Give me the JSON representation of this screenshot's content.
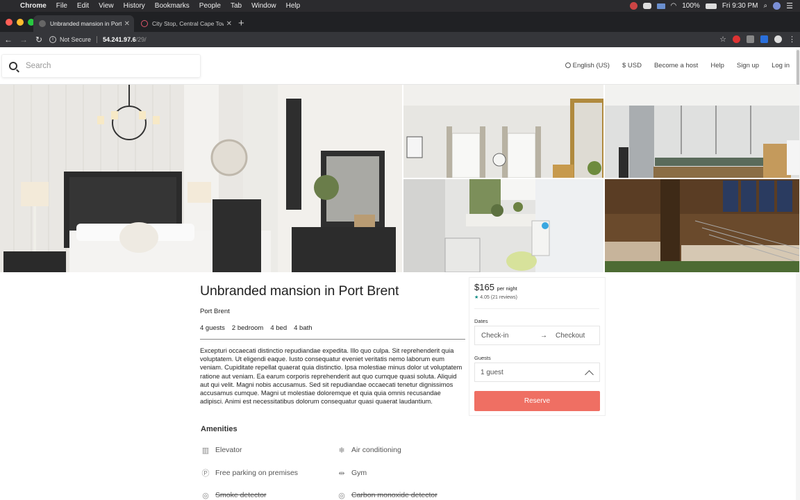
{
  "menubar": {
    "app": "Chrome",
    "items": [
      "File",
      "Edit",
      "View",
      "History",
      "Bookmarks",
      "People",
      "Tab",
      "Window",
      "Help"
    ],
    "battery": "100%",
    "clock": "Fri 9:30 PM"
  },
  "browser": {
    "tabs": [
      {
        "title": "Unbranded mansion in Port Bren",
        "active": true
      },
      {
        "title": "City Stop, Central Cape Town, Lo",
        "active": false
      }
    ],
    "address": {
      "security": "Not Secure",
      "host": "54.241.97.6",
      "path": "/29/"
    }
  },
  "header": {
    "search_placeholder": "Search",
    "nav": {
      "language": "English (US)",
      "currency": "$ USD",
      "host": "Become a host",
      "help": "Help",
      "signup": "Sign up",
      "login": "Log in"
    }
  },
  "listing": {
    "title": "Unbranded mansion in Port Brent",
    "city": "Port Brent",
    "specs": {
      "guests": "4 guests",
      "bedrooms": "2 bedroom",
      "beds": "4 bed",
      "baths": "4 bath"
    },
    "description": "Excepturi occaecati distinctio repudiandae expedita. Illo quo culpa. Sit reprehenderit quia voluptatem. Ut eligendi eaque. Iusto consequatur eveniet veritatis nemo laborum eum veniam. Cupiditate repellat quaerat quia distinctio. Ipsa molestiae minus dolor ut voluptatem ratione aut veniam. Ea earum corporis reprehenderit aut quo cumque quasi soluta. Aliquid aut qui velit. Magni nobis accusamus. Sed sit repudiandae occaecati tenetur dignissimos accusamus cumque. Magni ut molestiae doloremque et quia quia omnis recusandae adipisci. Animi est necessitatibus dolorum consequatur quasi quaerat laudantium.",
    "amenities_title": "Amenities",
    "amenities": [
      {
        "label": "Elevator",
        "icon": "elevator-icon",
        "available": true
      },
      {
        "label": "Air conditioning",
        "icon": "snowflake-icon",
        "available": true
      },
      {
        "label": "Free parking on premises",
        "icon": "parking-icon",
        "available": true
      },
      {
        "label": "Gym",
        "icon": "dumbbell-icon",
        "available": true
      },
      {
        "label": "Smoke detector",
        "icon": "smoke-detector-icon",
        "available": false
      },
      {
        "label": "Carbon monoxide detector",
        "icon": "co-detector-icon",
        "available": false
      }
    ]
  },
  "booking": {
    "price": "$165",
    "per_night": "per night",
    "rating": "4.05",
    "reviews": "(21 reviews)",
    "dates_label": "Dates",
    "checkin_placeholder": "Check-in",
    "checkout_placeholder": "Checkout",
    "guests_label": "Guests",
    "guests_value": "1 guest",
    "reserve_label": "Reserve"
  },
  "colors": {
    "accent": "#ef6f63",
    "star": "#0a8a83"
  }
}
